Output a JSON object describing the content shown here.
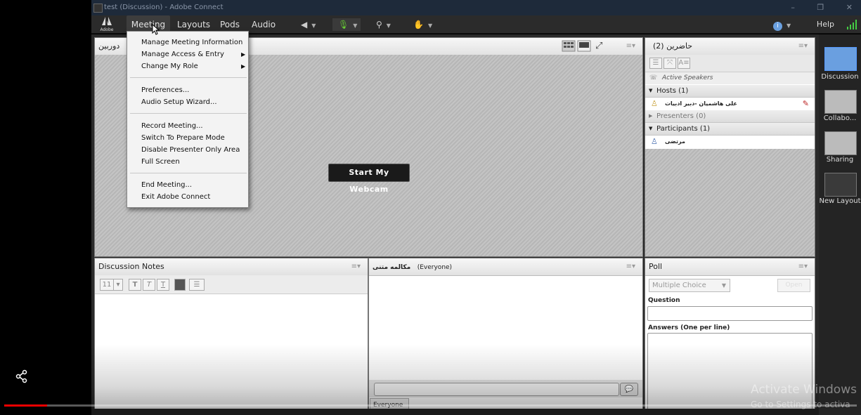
{
  "titlebar": {
    "title": "test (Discussion) - Adobe Connect"
  },
  "menubar": {
    "logo": "Adobe",
    "meeting": "Meeting",
    "layouts": "Layouts",
    "pods": "Pods",
    "audio": "Audio",
    "help": "Help"
  },
  "dropdown": {
    "items": [
      "Manage Meeting Information",
      "Manage Access & Entry",
      "Change My Role",
      "Preferences...",
      "Audio Setup Wizard...",
      "Record Meeting...",
      "Switch To Prepare Mode",
      "Disable Presenter Only Area",
      "Full Screen",
      "End Meeting...",
      "Exit Adobe Connect"
    ]
  },
  "cam_pod": {
    "title": "دوربین",
    "button": "Start My Webcam"
  },
  "attendees": {
    "title": "حاضرین",
    "count": "(2)",
    "active_speakers": "Active Speakers",
    "hosts": "Hosts (1)",
    "host_name": "علی هاشمیان -دبیر ادبیات",
    "presenters": "Presenters (0)",
    "participants": "Participants (1)",
    "participant_name": "مرتضی"
  },
  "layouts": {
    "items": [
      "Discussion",
      "Collabo...",
      "Sharing",
      "New Layout"
    ]
  },
  "notes": {
    "title": "Discussion Notes",
    "font_size": "11"
  },
  "chat": {
    "title": "مکالمه متنی",
    "audience": "(Everyone)",
    "tab": "Everyone"
  },
  "poll": {
    "title": "Poll",
    "type": "Multiple Choice",
    "open": "Open",
    "question_label": "Question",
    "answers_label": "Answers (One per line)"
  },
  "watermark": {
    "line1": "Activate Windows",
    "line2": "Go to Settings to activa"
  },
  "video": {
    "progress": 0.05
  },
  "colors": {
    "accent_bg": "#2b2b2b",
    "progress": "#e00000"
  }
}
